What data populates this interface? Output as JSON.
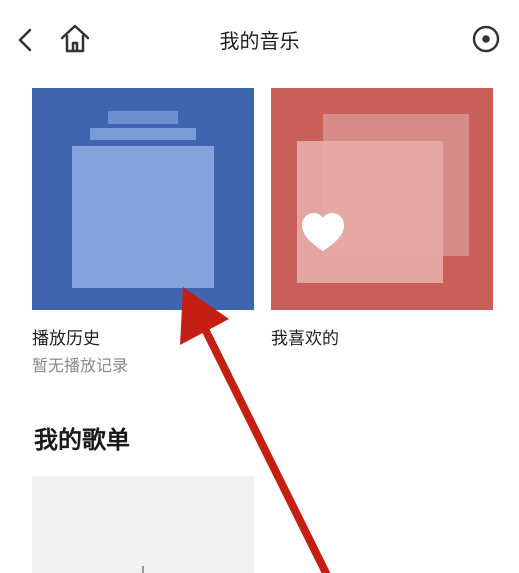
{
  "header": {
    "title": "我的音乐",
    "back_icon": "chevron-left-icon",
    "home_icon": "home-icon",
    "more_icon": "radio-target-icon"
  },
  "cards": {
    "history": {
      "title": "播放历史",
      "subtitle": "暂无播放记录",
      "cover_color": "#3f64b0",
      "cover_icon": "stacked-albums-icon"
    },
    "likes": {
      "title": "我喜欢的",
      "cover_color": "#c95f58",
      "cover_icon": "heart-icon"
    }
  },
  "section": {
    "title": "我的歌单"
  },
  "annotation": {
    "color": "#c51f14",
    "icon": "red-arrow-pointer"
  }
}
